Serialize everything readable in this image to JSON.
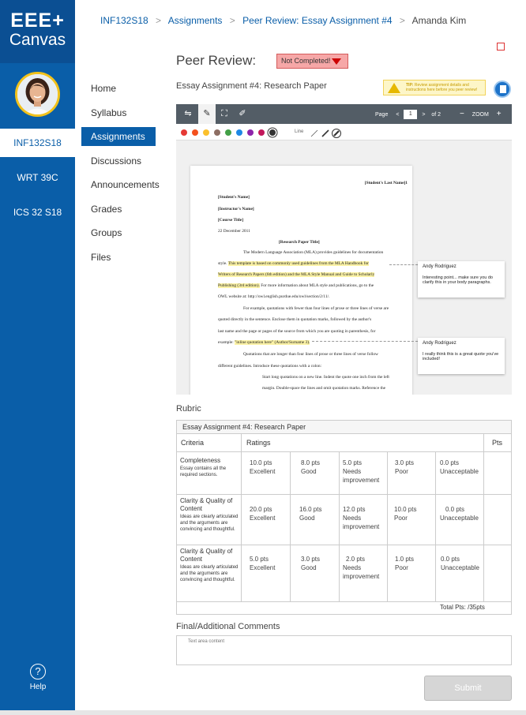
{
  "logo": {
    "line1": "EEE+",
    "line2": "Canvas"
  },
  "courses": [
    {
      "label": "INF132S18",
      "active": true
    },
    {
      "label": "WRT 39C",
      "active": false
    },
    {
      "label": "ICS 32 S18",
      "active": false
    }
  ],
  "help": {
    "label": "Help",
    "icon": "?"
  },
  "nav": [
    {
      "label": "Home"
    },
    {
      "label": "Syllabus"
    },
    {
      "label": "Assignments"
    },
    {
      "label": "Discussions"
    },
    {
      "label": "Announcements"
    },
    {
      "label": "Grades"
    },
    {
      "label": "Groups"
    },
    {
      "label": "Files"
    }
  ],
  "breadcrumb": {
    "items": [
      "INF132S18",
      "Assignments",
      "Peer Review: Essay Assignment #4",
      "Amanda Kim"
    ],
    "sep1": ">",
    "sep2": ">",
    "sep3": ">"
  },
  "header": {
    "title": "Peer Review:",
    "status": "Not Completed!"
  },
  "essay_title": "Essay Assignment #4: Research Paper",
  "tip": {
    "bold": "TIP:",
    "text": "Review assignment details and instructions here before you peer review!"
  },
  "toolbar": {
    "page_label": "Page",
    "page_value": "1",
    "of_pages": "of 2",
    "zoom_label": "ZOOM",
    "minus": "−",
    "plus": "+",
    "prev": "<",
    "next": ">",
    "line_label": "Line"
  },
  "colors": [
    "#e53935",
    "#f4511e",
    "#fbc02d",
    "#8d6e63",
    "#43a047",
    "#1e88e5",
    "#8e24aa",
    "#c2185b",
    "#333333"
  ],
  "paper": {
    "header_right": "[Student's Last Name]1",
    "student": "[Student's Name]",
    "instructor": "[Instructor's Name]",
    "course": "[Course Title]",
    "date": "22 December 2011",
    "title": "[Research Paper Title]",
    "p1a": "The Modern Language Association (MLA) provides guidelines for documentation",
    "p1b_plain": "style. ",
    "p1b_hl": "This template is based on commonly used guidelines from the MLA Handbook for",
    "p1c_hl": "Writers of Research Papers (6th edition) and the MLA Style Manual and Guide to Scholarly",
    "p1d_hl": "Publishing (3rd edition).",
    "p1d_plain": " For more information about MLA style and publications, go to the",
    "p1e": "OWL website at: http://owl.english.purdue.edu/owl/section/2/11/.",
    "p2a": "For example, quotations with fewer than four lines of prose or three lines of verse are",
    "p2b": "quoted directly in the sentence. Enclose them in quotation marks, followed by the author's",
    "p2c": "last name and the page or pages of the source from which you are quoting in parenthesis, for",
    "p2d_plain": "example: ",
    "p2d_hl": "\"inline quotation here\" (Author/Surname 3).",
    "p3a": "Quotations that are longer than four lines of prose or three lines of verse follow",
    "p3b": "different guidelines. Introduce these quotations with a colon:",
    "p4a": "Start long quotations on a new line. Indent the quote one inch from the left",
    "p4b": "margin. Double-space the lines and omit quotation marks. Reference the"
  },
  "comments": [
    {
      "author": "Andy Rodriguez",
      "text": "Interesting point... make sure you do clarify this in your body paragraphs."
    },
    {
      "author": "Andy Rodriguez",
      "text": "I really think this is a great quote you've included!"
    }
  ],
  "rubric": {
    "label": "Rubric",
    "title": "Essay Assignment #4: Research Paper",
    "col_criteria": "Criteria",
    "col_ratings": "Ratings",
    "col_pts": "Pts",
    "rows": [
      {
        "title": "Completeness",
        "desc": "Essay contains all the required sections.",
        "ratings": [
          {
            "pts": "10.0 pts",
            "label": "Excellent"
          },
          {
            "pts": "8.0 pts",
            "label": "Good"
          },
          {
            "pts": "5.0 pts",
            "label": "Needs improvement"
          },
          {
            "pts": "3.0 pts",
            "label": "Poor"
          },
          {
            "pts": "0.0 pts",
            "label": "Unacceptable"
          }
        ]
      },
      {
        "title": "Clarity & Quality of Content",
        "desc": "Ideas are clearly articulated and the arguments are convincing and thoughtful.",
        "ratings": [
          {
            "pts": "20.0 pts",
            "label": "Excellent"
          },
          {
            "pts": "16.0 pts",
            "label": "Good"
          },
          {
            "pts": "12.0 pts",
            "label": "Needs improvement"
          },
          {
            "pts": "10.0 pts",
            "label": "Poor"
          },
          {
            "pts": "0.0 pts",
            "label": "Unacceptable"
          }
        ]
      },
      {
        "title": "Clarity & Quality of Content",
        "desc": "Ideas are clearly articulated and the arguments are convincing and thoughtful.",
        "ratings": [
          {
            "pts": "5.0 pts",
            "label": "Excellent"
          },
          {
            "pts": "3.0 pts",
            "label": "Good"
          },
          {
            "pts": "2.0 pts",
            "label": "Needs improvement"
          },
          {
            "pts": "1.0 pts",
            "label": "Poor"
          },
          {
            "pts": "0.0 pts",
            "label": "Unacceptable"
          }
        ]
      }
    ],
    "total": "Total Pts: /35pts"
  },
  "final_comments": {
    "label": "Final/Additional Comments",
    "placeholder": "Text area content"
  },
  "submit_label": "Submit"
}
